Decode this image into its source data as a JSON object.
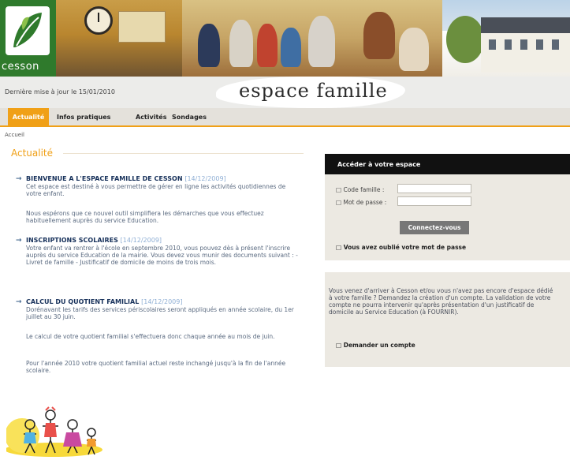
{
  "header": {
    "logo_text": "cesson",
    "last_update": "Dernière mise à jour le 15/01/2010",
    "brand_title": "espace famille"
  },
  "nav": {
    "tabs": [
      "Actualité",
      "Infos pratiques",
      "Activités",
      "Sondages"
    ],
    "active_tab": "Actualité"
  },
  "breadcrumb": "Accueil",
  "section_title": "Actualité",
  "articles": [
    {
      "title": "BIENVENUE A L'ESPACE FAMILLE DE CESSON",
      "date": "[14/12/2009]",
      "paragraphs": [
        "Cet espace est destiné à vous permettre de gérer en ligne les activités quotidiennes de votre enfant.",
        "Nous espérons que ce nouvel outil simplifiera les démarches que vous effectuez habituellement auprès du service Education."
      ]
    },
    {
      "title": "INSCRIPTIONS SCOLAIRES",
      "date": "[14/12/2009]",
      "paragraphs": [
        "Votre enfant va rentrer à l'école en septembre 2010, vous pouvez dès à présent l'inscrire auprès du service Education de la mairie. Vous devez vous munir des documents suivant : - Livret de famille - Justificatif de domicile de moins de trois mois."
      ]
    },
    {
      "title": "CALCUL DU QUOTIENT FAMILIAL",
      "date": "[14/12/2009]",
      "paragraphs": [
        "Dorénavant les tarifs des services périscolaires seront appliqués en année scolaire, du 1er juillet au 30 juin.",
        "Le calcul de votre quotient familial s'effectuera donc chaque année au mois de juin.",
        "Pour l'année 2010 votre quotient familial actuel reste inchangé jusqu'à la fin de l'année scolaire."
      ]
    }
  ],
  "login": {
    "title": "Accéder à votre espace",
    "code_label": "Code famille :",
    "password_label": "Mot de passe :",
    "code_value": "",
    "password_value": "",
    "connect_label": "Connectez-vous",
    "forgot_label": "Vous avez oublié votre mot de passe"
  },
  "info": {
    "text": "Vous venez d'arriver à Cesson et/ou vous n'avez pas encore d'espace dédié à votre famille ? Demandez la création d'un compte. La validation de votre compte ne pourra intervenir qu'après présentation d'un justificatif de domicile au Service Education (à FOURNIR).",
    "request_label": "Demander un compte"
  },
  "colors": {
    "accent": "#f0a017",
    "logo_green": "#2f7a2c",
    "heading_blue": "#16305a",
    "login_header": "#111111"
  }
}
